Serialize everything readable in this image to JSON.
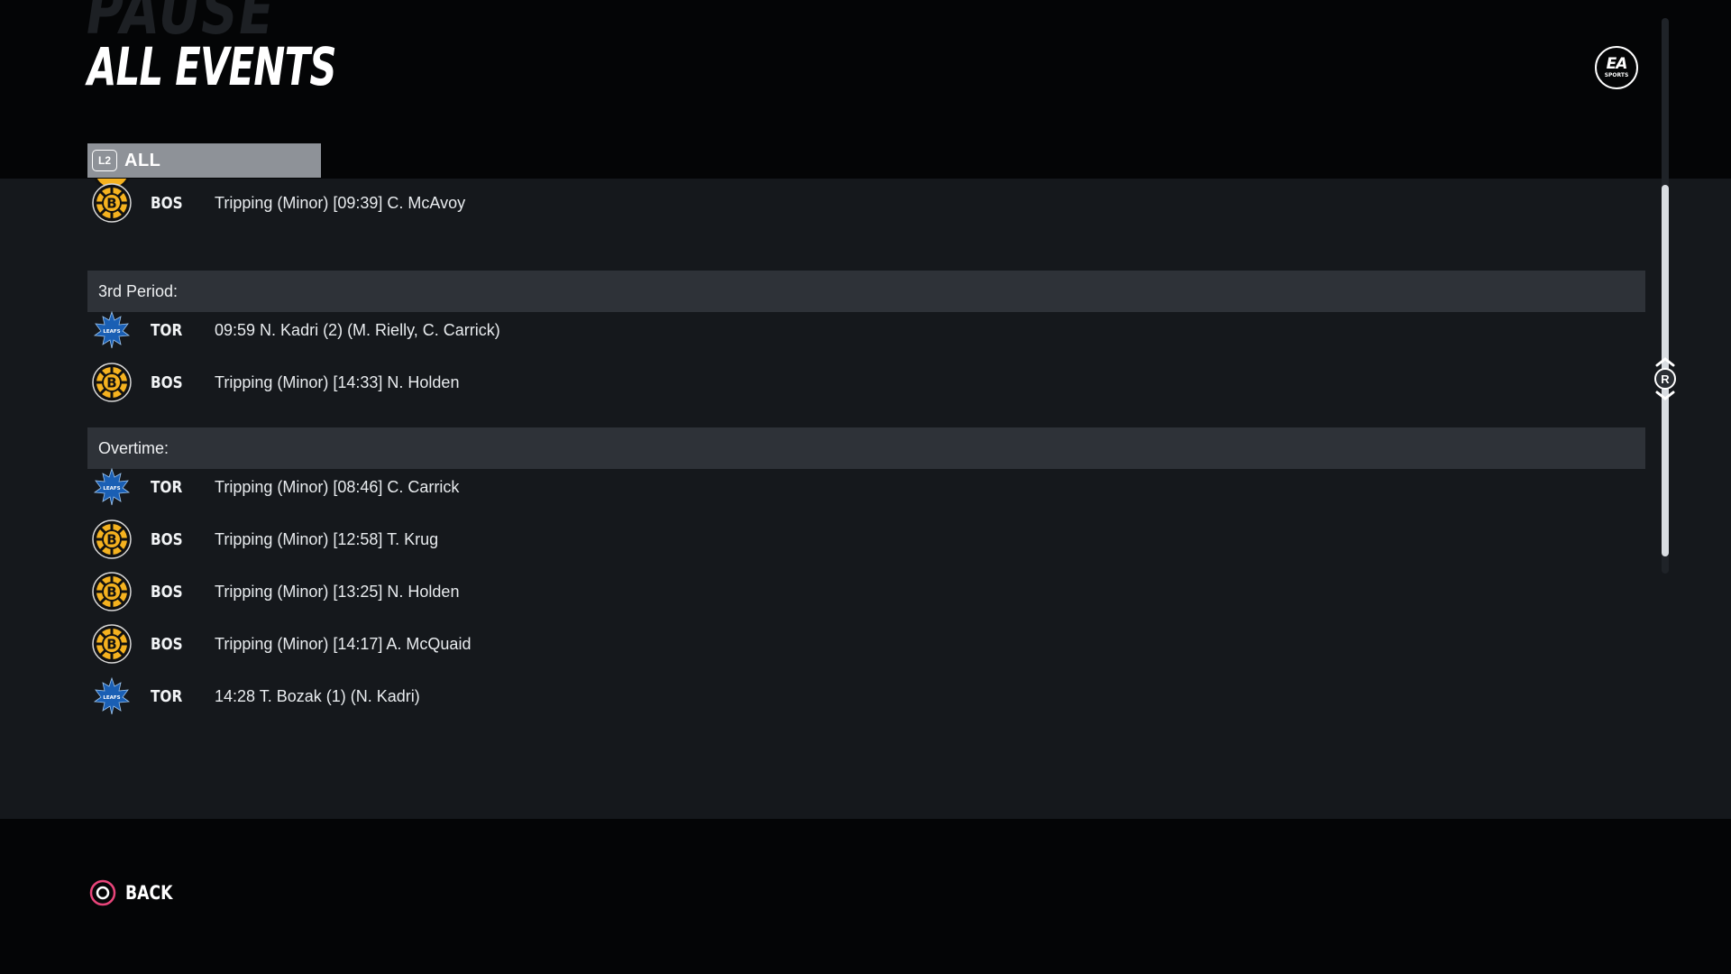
{
  "header": {
    "ghost_title": "PAUSE",
    "title": "ALL EVENTS",
    "logo_text": "EA",
    "logo_subtext": "SPORTS"
  },
  "tab": {
    "badge": "L2",
    "label": "ALL"
  },
  "events": [
    {
      "kind": "event",
      "team": "BOS",
      "logo": "bruins-logo-icon",
      "text": "Tripping (Minor) [09:39] C. McAvoy"
    },
    {
      "kind": "header",
      "text": "3rd Period:"
    },
    {
      "kind": "event",
      "team": "TOR",
      "logo": "maple-leafs-logo-icon",
      "text": "09:59 N. Kadri (2) (M. Rielly, C. Carrick)"
    },
    {
      "kind": "event",
      "team": "BOS",
      "logo": "bruins-logo-icon",
      "text": "Tripping (Minor) [14:33] N. Holden"
    },
    {
      "kind": "header",
      "text": "Overtime:"
    },
    {
      "kind": "event",
      "team": "TOR",
      "logo": "maple-leafs-logo-icon",
      "text": "Tripping (Minor) [08:46] C. Carrick"
    },
    {
      "kind": "event",
      "team": "BOS",
      "logo": "bruins-logo-icon",
      "text": "Tripping (Minor) [12:58] T. Krug"
    },
    {
      "kind": "event",
      "team": "BOS",
      "logo": "bruins-logo-icon",
      "text": "Tripping (Minor) [13:25] N. Holden"
    },
    {
      "kind": "event",
      "team": "BOS",
      "logo": "bruins-logo-icon",
      "text": "Tripping (Minor) [14:17] A. McQuaid"
    },
    {
      "kind": "event",
      "team": "TOR",
      "logo": "maple-leafs-logo-icon",
      "text": "14:28 T. Bozak (1) (N. Kadri)"
    }
  ],
  "scroll": {
    "stick_label": "R"
  },
  "footer": {
    "back_label": "BACK"
  },
  "colors": {
    "bruins_gold": "#f5b21f",
    "bruins_black": "#111111",
    "leafs_blue": "#1a5fb4",
    "back_button": "#e8457a",
    "tab_active": "#8e9298",
    "section_header": "#2e3238"
  }
}
